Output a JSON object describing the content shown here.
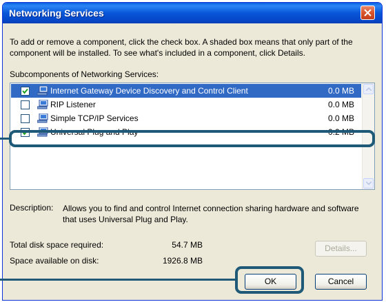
{
  "window": {
    "title": "Networking Services"
  },
  "intro": {
    "text": "To add or remove a component, click the check box. A shaded box means that only part of the component will be installed. To see what's included in a component, click Details."
  },
  "subcomponents": {
    "label": "Subcomponents of Networking Services:",
    "items": [
      {
        "label": "Internet Gateway Device Discovery and Control Client",
        "size": "0.0 MB",
        "checked": true,
        "selected": true
      },
      {
        "label": "RIP Listener",
        "size": "0.0 MB",
        "checked": false,
        "selected": false
      },
      {
        "label": "Simple TCP/IP Services",
        "size": "0.0 MB",
        "checked": false,
        "selected": false
      },
      {
        "label": "Universal Plug and Play",
        "size": "0.2 MB",
        "checked": true,
        "selected": false
      }
    ]
  },
  "description": {
    "label": "Description:",
    "text": "Allows you to find and control Internet connection sharing hardware and software that uses Universal Plug and Play."
  },
  "disk": {
    "required_label": "Total disk space required:",
    "required_value": "54.7 MB",
    "available_label": "Space available on disk:",
    "available_value": "1926.8 MB"
  },
  "buttons": {
    "details": "Details...",
    "ok": "OK",
    "cancel": "Cancel"
  },
  "colors": {
    "titlebar": "#0a5fe0",
    "selection": "#316ac5",
    "highlight": "#1e5a78",
    "dialog_bg": "#ece9d8"
  }
}
